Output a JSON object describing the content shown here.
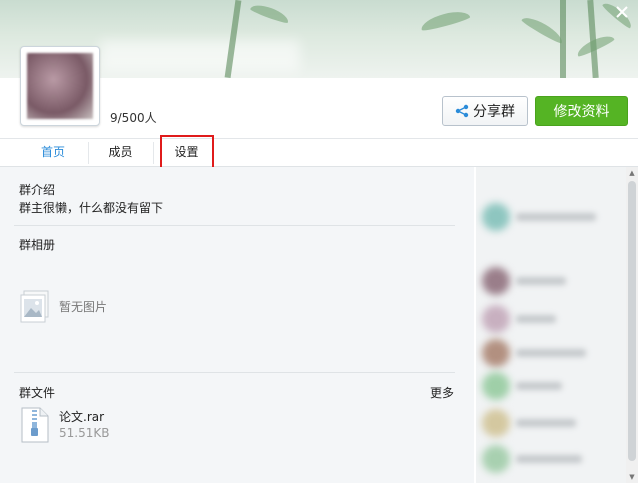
{
  "header": {
    "member_count": "9/500人",
    "share_label": "分享群",
    "edit_label": "修改资料"
  },
  "tabs": [
    {
      "label": "首页",
      "active": true
    },
    {
      "label": "成员",
      "active": false
    },
    {
      "label": "设置",
      "active": false
    }
  ],
  "intro": {
    "title": "群介绍",
    "text": "群主很懒，什么都没有留下"
  },
  "album": {
    "title": "群相册",
    "empty_text": "暂无图片"
  },
  "files": {
    "title": "群文件",
    "more_label": "更多",
    "items": [
      {
        "name": "论文.rar",
        "size": "51.51KB"
      }
    ]
  },
  "colors": {
    "accent": "#2a8bd9",
    "primary_button": "#55b424",
    "highlight_box": "#e01b1b"
  }
}
